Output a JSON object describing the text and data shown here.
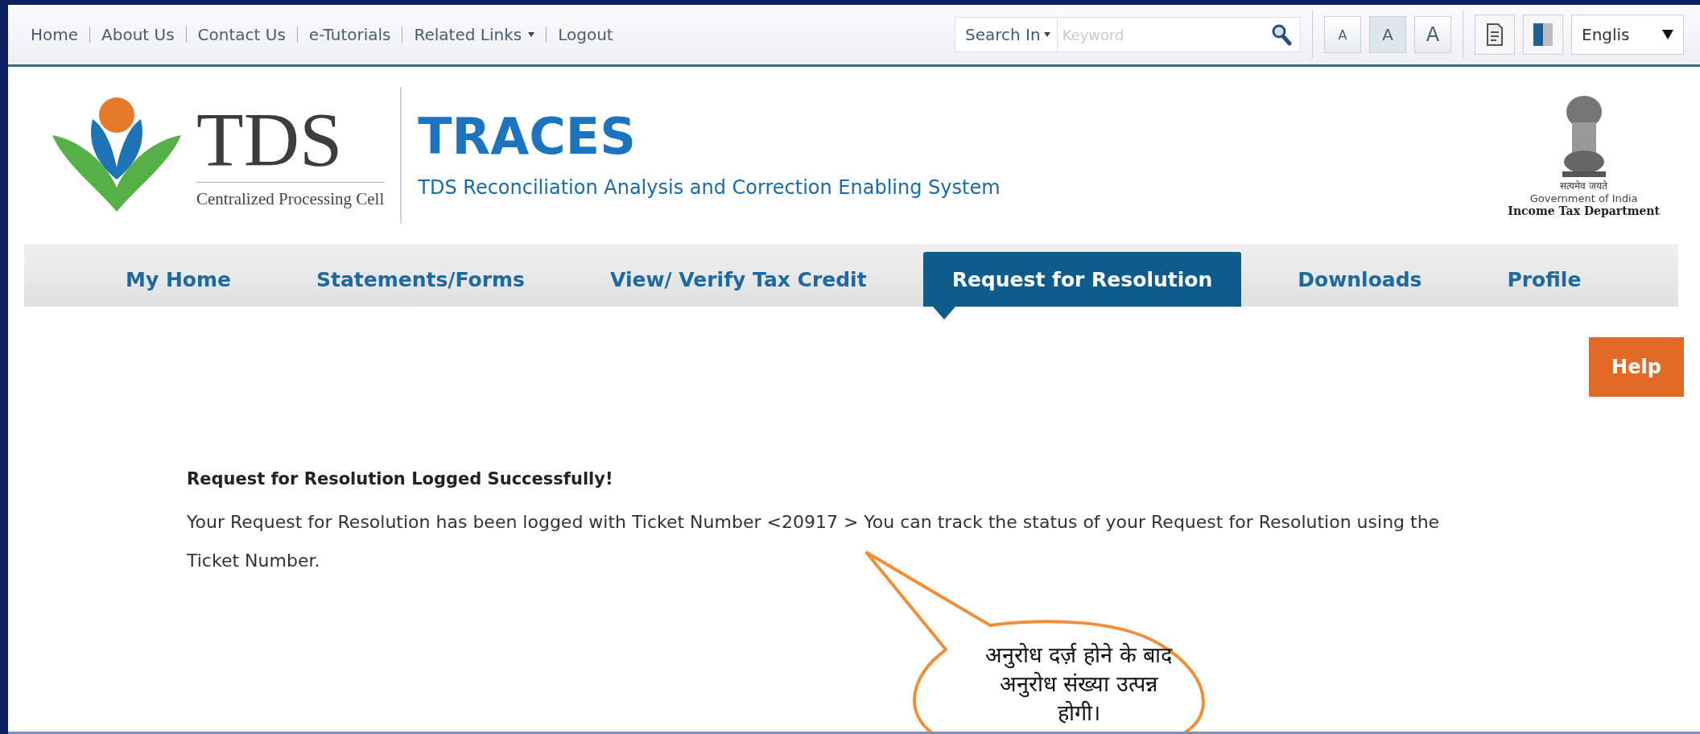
{
  "top_links": [
    {
      "label": "Home"
    },
    {
      "label": "About Us"
    },
    {
      "label": "Contact Us"
    },
    {
      "label": "e-Tutorials"
    },
    {
      "label": "Related Links",
      "dropdown": true
    },
    {
      "label": "Logout"
    }
  ],
  "search": {
    "scope": "Search In",
    "placeholder": "Keyword"
  },
  "font_size_buttons": [
    {
      "label": "A",
      "selected": false
    },
    {
      "label": "A",
      "selected": true
    },
    {
      "label": "A",
      "selected": false
    }
  ],
  "language": "Englis",
  "header": {
    "logo_text": "TDS",
    "logo_subtitle": "Centralized Processing Cell",
    "title": "TRACES",
    "subtitle": "TDS Reconciliation Analysis and Correction Enabling System",
    "emblem_motto": "सत्यमेव जयते",
    "emblem_line_1": "Government of India",
    "emblem_line_2": "Income Tax Department"
  },
  "nav_tabs": [
    {
      "label": "My Home",
      "selected": false
    },
    {
      "label": "Statements/Forms",
      "selected": false
    },
    {
      "label": "View/ Verify Tax Credit",
      "selected": false
    },
    {
      "label": "Request for Resolution",
      "selected": true
    },
    {
      "label": "Downloads",
      "selected": false
    },
    {
      "label": "Profile",
      "selected": false
    }
  ],
  "help_button": "Help",
  "message": {
    "title": "Request for Resolution Logged Successfully!",
    "body": "Your Request for Resolution has been logged with Ticket Number <20917 > You can track the status of your Request for Resolution using the Ticket Number."
  },
  "callout": "अनुरोध दर्ज़ होने के बाद अनुरोध संख्या उत्पन्न होगी।"
}
